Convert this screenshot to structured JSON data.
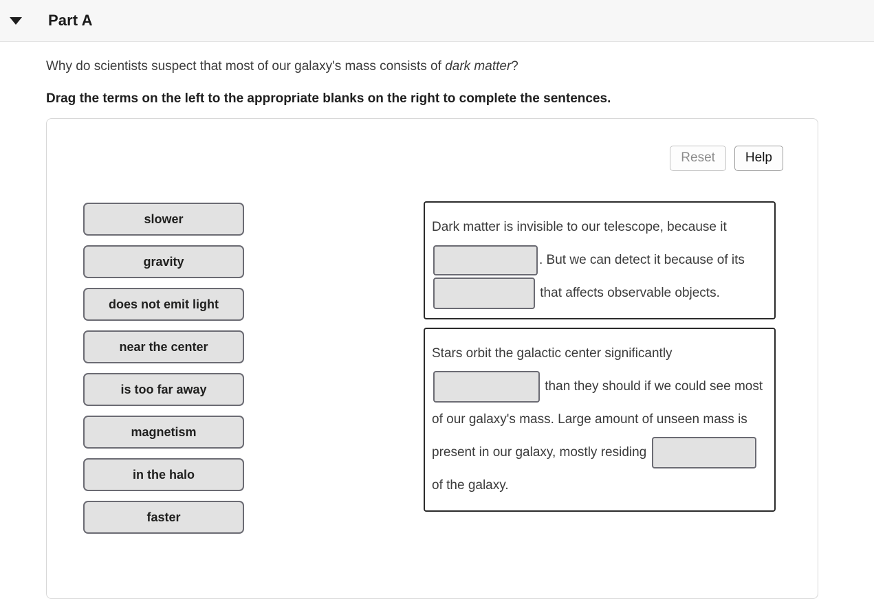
{
  "header": {
    "collapse_icon": "chevron-down-icon",
    "title": "Part A"
  },
  "question": {
    "prompt_before_italic": "Why do scientists suspect that most of our galaxy's mass consists of ",
    "prompt_italic": "dark matter",
    "prompt_after_italic": "?",
    "instruction": "Drag the terms on the left to the appropriate blanks on the right to complete the sentences."
  },
  "toolbar": {
    "reset_label": "Reset",
    "help_label": "Help"
  },
  "term_bank": {
    "terms": [
      {
        "label": "slower"
      },
      {
        "label": "gravity"
      },
      {
        "label": "does not emit light"
      },
      {
        "label": "near the center"
      },
      {
        "label": "is too far away"
      },
      {
        "label": "magnetism"
      },
      {
        "label": "in the halo"
      },
      {
        "label": "faster"
      }
    ]
  },
  "sentences": [
    {
      "id": "sentence-1",
      "seg1": "Dark matter is invisible to our telescope, because it",
      "seg2": ". But we can detect it because of its",
      "seg3": "that affects observable objects.",
      "blank1_value": "",
      "blank2_value": ""
    },
    {
      "id": "sentence-2",
      "seg1": "Stars orbit the galactic center significantly",
      "seg2": "than they should if we could see most of our galaxy's mass. Large amount of unseen mass is present in our galaxy, mostly residing",
      "seg3": "of the galaxy.",
      "blank1_value": "",
      "blank2_value": ""
    }
  ],
  "colors": {
    "header_bg": "#f7f7f7",
    "tile_fill": "#e2e2e2",
    "tile_border": "#6b6b73",
    "sentence_border": "#2b2b2b",
    "panel_border": "#d8d8d8",
    "text": "#3b3b3b"
  }
}
